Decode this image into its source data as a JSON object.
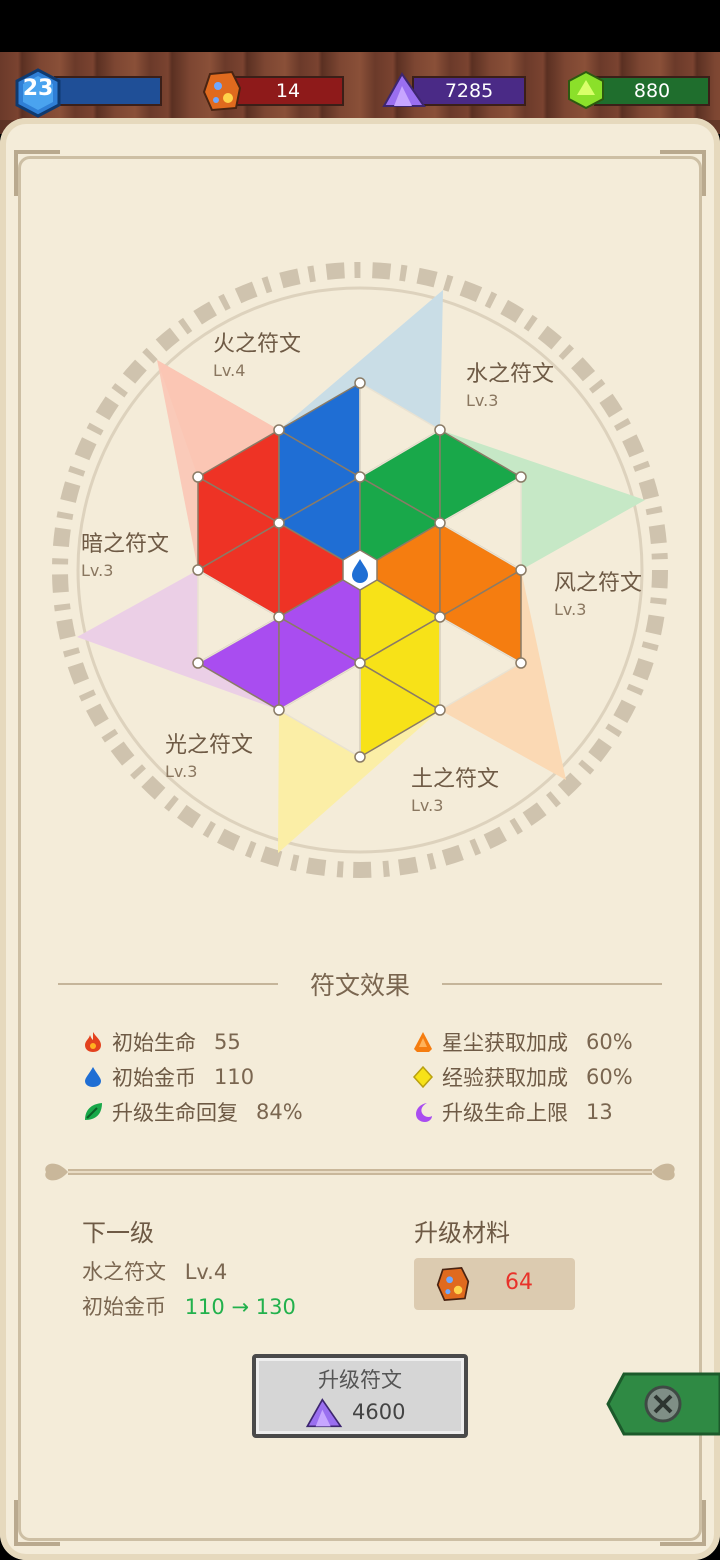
{
  "resources": {
    "level": "23",
    "ore": "14",
    "stardust": "7285",
    "gems": "880"
  },
  "runes": [
    {
      "name": "火之符文",
      "level": "Lv.4"
    },
    {
      "name": "水之符文",
      "level": "Lv.3"
    },
    {
      "name": "风之符文",
      "level": "Lv.3"
    },
    {
      "name": "土之符文",
      "level": "Lv.3"
    },
    {
      "name": "光之符文",
      "level": "Lv.3"
    },
    {
      "name": "暗之符文",
      "level": "Lv.3"
    }
  ],
  "effects": {
    "title": "符文效果",
    "items": [
      {
        "label": "初始生命",
        "value": "55",
        "icon": "fire-icon"
      },
      {
        "label": "初始金币",
        "value": "110",
        "icon": "water-drop-icon"
      },
      {
        "label": "升级生命回复",
        "value": "84%",
        "icon": "leaf-icon"
      },
      {
        "label": "星尘获取加成",
        "value": "60%",
        "icon": "earth-icon"
      },
      {
        "label": "经验获取加成",
        "value": "60%",
        "icon": "light-diamond-icon"
      },
      {
        "label": "升级生命上限",
        "value": "13",
        "icon": "moon-icon"
      }
    ]
  },
  "next_level": {
    "title": "下一级",
    "rune": "水之符文",
    "rune_level": "Lv.4",
    "stat_label": "初始金币",
    "stat_change": "110 → 130"
  },
  "materials": {
    "title": "升级材料",
    "ore_cost": "64"
  },
  "upgrade_button": {
    "label": "升级符文",
    "cost": "4600"
  },
  "colors": {
    "fire": "#ee3325",
    "water": "#1f6ed4",
    "wind": "#19a84a",
    "earth": "#f57d10",
    "light": "#f7e218",
    "dark": "#a94df0"
  }
}
